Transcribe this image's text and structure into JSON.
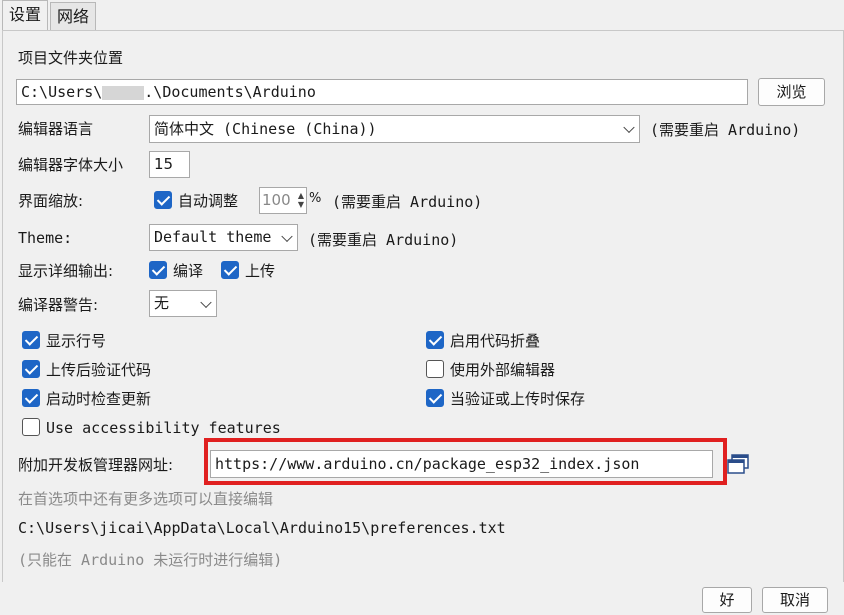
{
  "tabs": [
    {
      "label": "设置"
    },
    {
      "label": "网络"
    }
  ],
  "sketchbook": {
    "label": "项目文件夹位置",
    "path_prefix": "C:\\Users\\",
    "path_suffix": ".\\Documents\\Arduino",
    "browse": "浏览"
  },
  "language": {
    "label": "编辑器语言",
    "value": "简体中文 (Chinese (China))",
    "note": "(需要重启 Arduino)"
  },
  "font_size": {
    "label": "编辑器字体大小",
    "value": "15"
  },
  "scale": {
    "label": "界面缩放:",
    "auto_label": "自动调整",
    "value": "100",
    "unit": "%",
    "note": "(需要重启 Arduino)"
  },
  "theme": {
    "label": "Theme:",
    "value": "Default theme",
    "note": "(需要重启 Arduino)"
  },
  "verbose": {
    "label": "显示详细输出:",
    "compile": "编译",
    "upload": "上传"
  },
  "warnings": {
    "label": "编译器警告:",
    "value": "无"
  },
  "options": {
    "show_line_numbers": "显示行号",
    "verify_after_upload": "上传后验证代码",
    "check_updates": "启动时检查更新",
    "accessibility": "Use accessibility features",
    "code_folding": "启用代码折叠",
    "external_editor": "使用外部编辑器",
    "save_on_verify": "当验证或上传时保存"
  },
  "board_urls": {
    "label": "附加开发板管理器网址:",
    "value": "https://www.arduino.cn/package_esp32_index.json"
  },
  "more_prefs": "在首选项中还有更多选项可以直接编辑",
  "prefs_path": "C:\\Users\\jicai\\AppData\\Local\\Arduino15\\preferences.txt",
  "edit_note": "(只能在 Arduino 未运行时进行编辑)",
  "buttons": {
    "ok": "好",
    "cancel": "取消"
  },
  "colors": {
    "accent": "#1e66c6",
    "highlight": "#e02020"
  }
}
